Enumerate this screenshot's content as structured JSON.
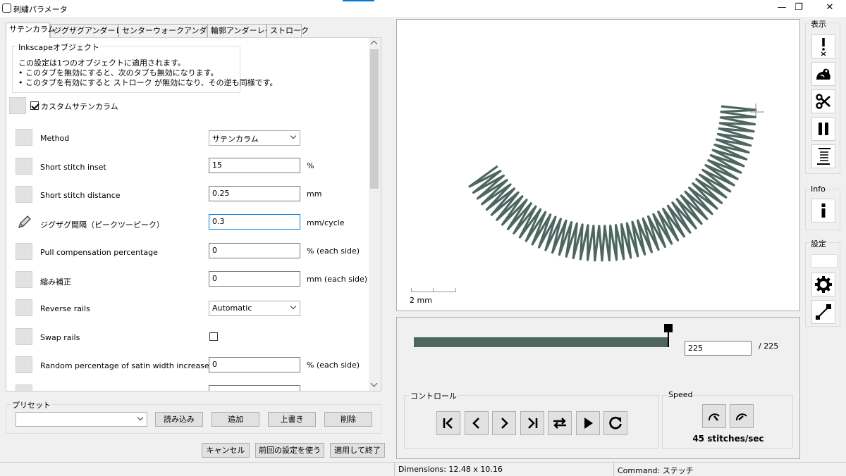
{
  "window": {
    "title": "刺繍パラメータ",
    "minimize": "—",
    "maximize": "❐",
    "close": "✕"
  },
  "tabs": [
    "サテンカラム",
    "ジグザグアンダーレイ",
    "センターウォークアンダーレイ",
    "輪郭アンダーレイ",
    "ストローク"
  ],
  "info_box": {
    "legend": "Inkscapeオブジェクト",
    "lines": [
      "この設定は1つのオブジェクトに適用されます。",
      "• このタブを無効にすると、次のタブも無効になります。",
      "• このタブを有効にすると ストローク が無効になり、その逆も同様です。"
    ]
  },
  "custom_satin": {
    "label": "カスタムサテンカラム",
    "checked": true
  },
  "params": [
    {
      "label": "Method",
      "type": "select",
      "value": "サテンカラム",
      "unit": ""
    },
    {
      "label": "Short stitch inset",
      "type": "text",
      "value": "15",
      "unit": "%"
    },
    {
      "label": "Short stitch distance",
      "type": "text",
      "value": "0.25",
      "unit": "mm"
    },
    {
      "label": "ジグザグ間隔（ピークツーピーク）",
      "type": "text",
      "value": "0.3",
      "unit": "mm/cycle"
    },
    {
      "label": "Pull compensation percentage",
      "type": "text",
      "value": "0",
      "unit": "% (each side)"
    },
    {
      "label": "縮み補正",
      "type": "text",
      "value": "0",
      "unit": "mm (each side)"
    },
    {
      "label": "Reverse rails",
      "type": "select",
      "value": "Automatic",
      "unit": ""
    },
    {
      "label": "Swap rails",
      "type": "checkbox",
      "value": "",
      "unit": ""
    },
    {
      "label": "Random percentage of satin width increase",
      "type": "text",
      "value": "0",
      "unit": "% (each side)"
    }
  ],
  "presets": {
    "legend": "プリセット",
    "load": "読み込み",
    "add": "追加",
    "overwrite": "上書き",
    "delete": "削除"
  },
  "footer": {
    "cancel": "キャンセル",
    "use_last": "前回の設定を使う",
    "apply_close": "適用して終了"
  },
  "preview": {
    "scale_label": "2 mm",
    "stitch_color": "#4d6660"
  },
  "playback": {
    "current": "225",
    "total": "/ 225",
    "progress": 1.0
  },
  "controls": {
    "legend": "コントロール",
    "buttons": [
      "first-icon",
      "prev-icon",
      "next-icon",
      "last-icon",
      "swap-icon",
      "play-icon",
      "restart-icon"
    ]
  },
  "speed": {
    "legend": "Speed",
    "value": "45 stitches/sec"
  },
  "sidebar": {
    "display_label": "表示",
    "info_label": "Info",
    "settings_label": "設定"
  },
  "status": {
    "dimensions": "Dimensions: 12.48 x 10.16",
    "command": "Command: ステッチ"
  }
}
